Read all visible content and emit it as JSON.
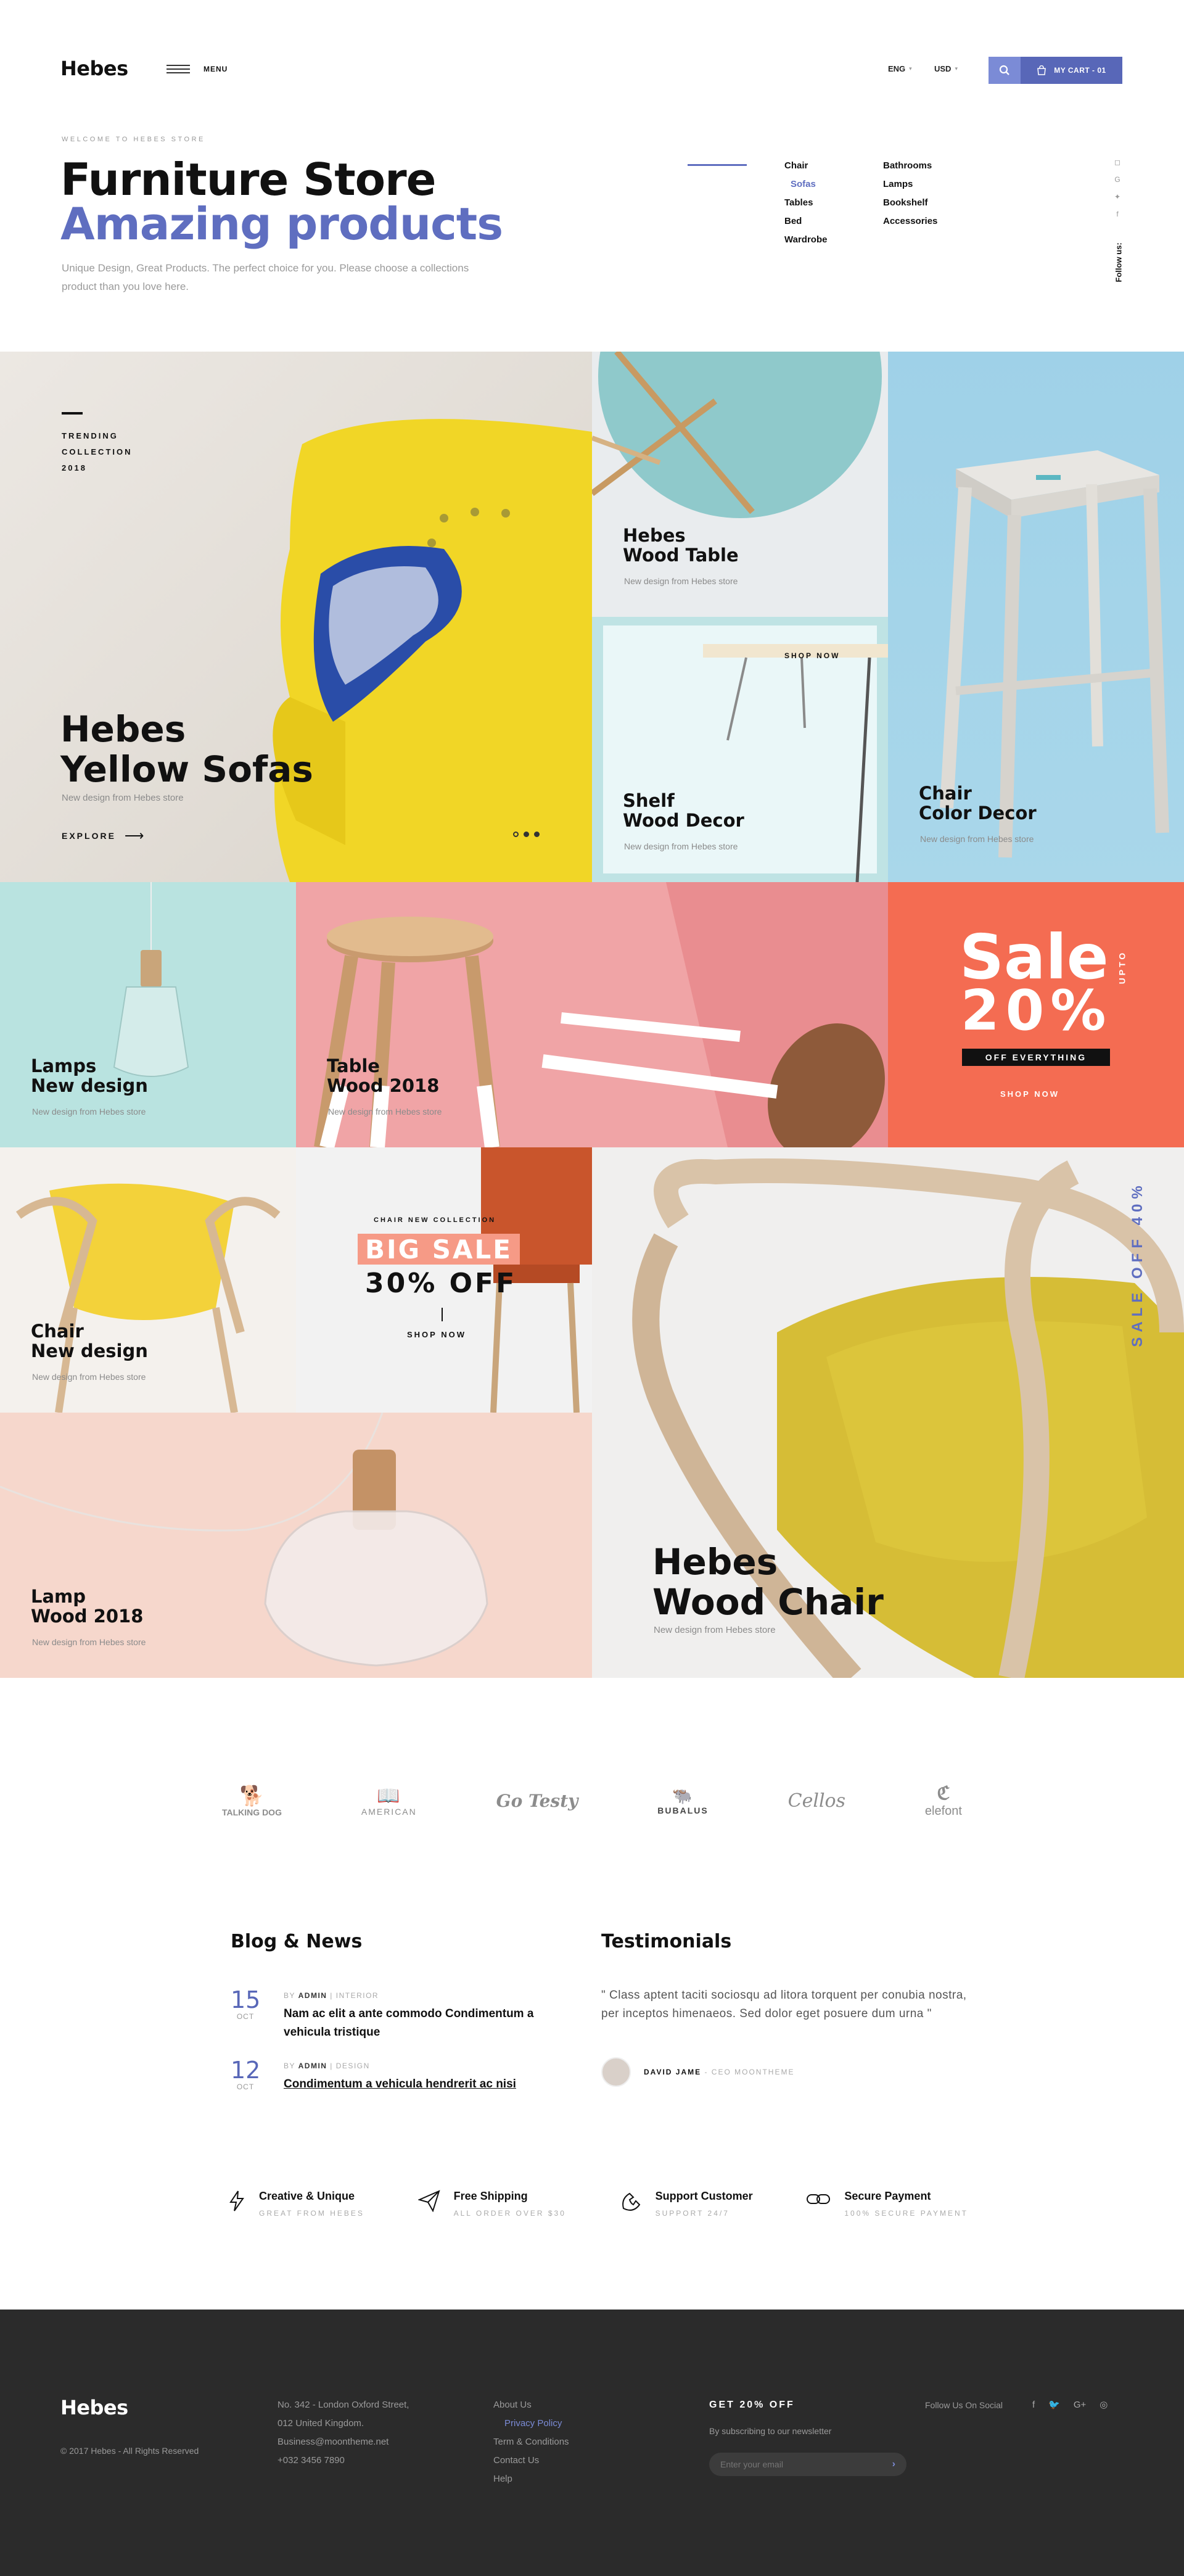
{
  "header": {
    "logo": "Hebes",
    "menu_label": "MENU",
    "lang": "ENG",
    "currency": "USD",
    "cart_label": "MY CART - 01",
    "colors": {
      "accent": "#5867b8",
      "accent_light": "#7b8bd6"
    }
  },
  "hero": {
    "welcome": "WELCOME TO HEBES STORE",
    "title_line1": "Furniture Store",
    "title_line2": "Amazing products",
    "description": "Unique Design, Great Products. The perfect choice for you. Please choose a collections product than you love here.",
    "categories_col1": [
      "Chair",
      "Sofas",
      "Tables",
      "Bed",
      "Wardrobe"
    ],
    "categories_col2": [
      "Bathrooms",
      "Lamps",
      "Bookshelf",
      "Accessories"
    ],
    "follow_label": "Follow us:"
  },
  "tiles": {
    "sofa": {
      "kicker1": "TRENDING",
      "kicker2": "COLLECTION",
      "kicker3": "2018",
      "title1": "Hebes",
      "title2": "Yellow Sofas",
      "sub": "New design from Hebes store",
      "cta": "EXPLORE"
    },
    "wood_table": {
      "title1": "Hebes",
      "title2": "Wood Table",
      "sub": "New design from Hebes store"
    },
    "shelf": {
      "cta": "SHOP NOW",
      "title1": "Shelf",
      "title2": "Wood Decor",
      "sub": "New design from Hebes store"
    },
    "chair_decor": {
      "title1": "Chair",
      "title2": "Color Decor",
      "sub": "New design from Hebes store"
    },
    "lamps": {
      "title1": "Lamps",
      "title2": "New design",
      "sub": "New design from Hebes store"
    },
    "table2018": {
      "title1": "Table",
      "title2": "Wood 2018",
      "sub": "New design from Hebes store"
    },
    "sale": {
      "word": "Sale",
      "upto": "UPTO",
      "percent": "20%",
      "tag": "OFF EVERYTHING",
      "cta": "SHOP NOW",
      "color": "#f46c52"
    },
    "chair_new": {
      "title1": "Chair",
      "title2": "New design",
      "sub": "New design from Hebes store"
    },
    "big_sale": {
      "kicker": "CHAIR NEW COLLECTION",
      "badge": "BIG SALE",
      "off": "30% OFF",
      "cta": "SHOP NOW"
    },
    "lamp_wood": {
      "title1": "Lamp",
      "title2": "Wood 2018",
      "sub": "New design from Hebes store"
    },
    "wood_chair": {
      "title1": "Hebes",
      "title2": "Wood Chair",
      "sub": "New design from Hebes store",
      "vertical": "SALE OFF 40%"
    }
  },
  "brands": [
    "TALKING DOG",
    "AMERICAN",
    "Go Testy",
    "BUBALUS",
    "Cellos",
    "elefont"
  ],
  "blog": {
    "title": "Blog & News",
    "by": "BY",
    "posts": [
      {
        "day": "15",
        "month": "OCT",
        "author": "ADMIN",
        "category": "INTERIOR",
        "title": "Nam ac elit a ante commodo Condimentum a vehicula tristique"
      },
      {
        "day": "12",
        "month": "OCT",
        "author": "ADMIN",
        "category": "DESIGN",
        "title": "Condimentum a vehicula hendrerit ac nisi"
      }
    ]
  },
  "testimonials": {
    "title": "Testimonials",
    "quote": "\" Class aptent taciti sociosqu ad litora torquent per conubia nostra, per inceptos himenaeos. Sed dolor eget posuere dum urna \"",
    "name": "DAVID JAME",
    "role": "CEO MOONTHEME"
  },
  "features": [
    {
      "icon": "bolt-icon",
      "title": "Creative & Unique",
      "sub": "GREAT FROM HEBES"
    },
    {
      "icon": "paper-plane-icon",
      "title": "Free Shipping",
      "sub": "ALL ORDER OVER $30"
    },
    {
      "icon": "phone-icon",
      "title": "Support Customer",
      "sub": "SUPPORT 24/7"
    },
    {
      "icon": "link-icon",
      "title": "Secure Payment",
      "sub": "100% SECURE PAYMENT"
    }
  ],
  "footer": {
    "logo": "Hebes",
    "copyright": "© 2017 Hebes - All Rights Reserved",
    "address": [
      "No. 342 - London Oxford Street,",
      "012 United Kingdom.",
      "Business@moontheme.net",
      "+032 3456 7890"
    ],
    "links": [
      "About Us",
      "Privacy Policy",
      "Term & Conditions",
      "Contact Us",
      "Help"
    ],
    "newsletter_title": "GET 20% OFF",
    "newsletter_text": "By subscribing to our newsletter",
    "email_placeholder": "Enter your email",
    "social_title": "Follow Us On Social"
  }
}
